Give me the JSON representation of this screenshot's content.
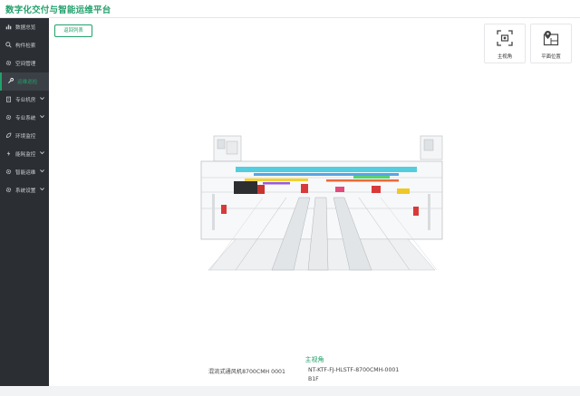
{
  "app": {
    "title": "数字化交付与智能运维平台"
  },
  "sidebar": {
    "items": [
      {
        "label": "数据总览",
        "icon": "bar-chart-icon",
        "has_submenu": false,
        "active": false
      },
      {
        "label": "构件检索",
        "icon": "search-icon",
        "has_submenu": false,
        "active": false
      },
      {
        "label": "空间管理",
        "icon": "gear-icon",
        "has_submenu": false,
        "active": false
      },
      {
        "label": "运维巡检",
        "icon": "wrench-icon",
        "has_submenu": false,
        "active": true
      },
      {
        "label": "专业机房",
        "icon": "building-icon",
        "has_submenu": true,
        "active": false
      },
      {
        "label": "专业系统",
        "icon": "gear-icon",
        "has_submenu": true,
        "active": false
      },
      {
        "label": "环境监控",
        "icon": "leaf-icon",
        "has_submenu": false,
        "active": false
      },
      {
        "label": "能耗监控",
        "icon": "bolt-icon",
        "has_submenu": true,
        "active": false
      },
      {
        "label": "智能运维",
        "icon": "gear-icon",
        "has_submenu": true,
        "active": false
      },
      {
        "label": "系统设置",
        "icon": "gear-icon",
        "has_submenu": true,
        "active": false
      }
    ]
  },
  "toolbar": {
    "back_label": "返回列表",
    "main_view_label": "主视角",
    "plan_position_label": "平面位置"
  },
  "viewer": {
    "view_name": "主视角",
    "equipment_name": "混流式通风机8700CMH 0001",
    "equipment_code": "NT-KTF-FJ-HLSTF-8700CMH-0001",
    "floor": "B1F"
  },
  "colors": {
    "accent": "#22a06b",
    "sidebar_bg": "#2b2f33",
    "header_bg": "#ffffff"
  }
}
